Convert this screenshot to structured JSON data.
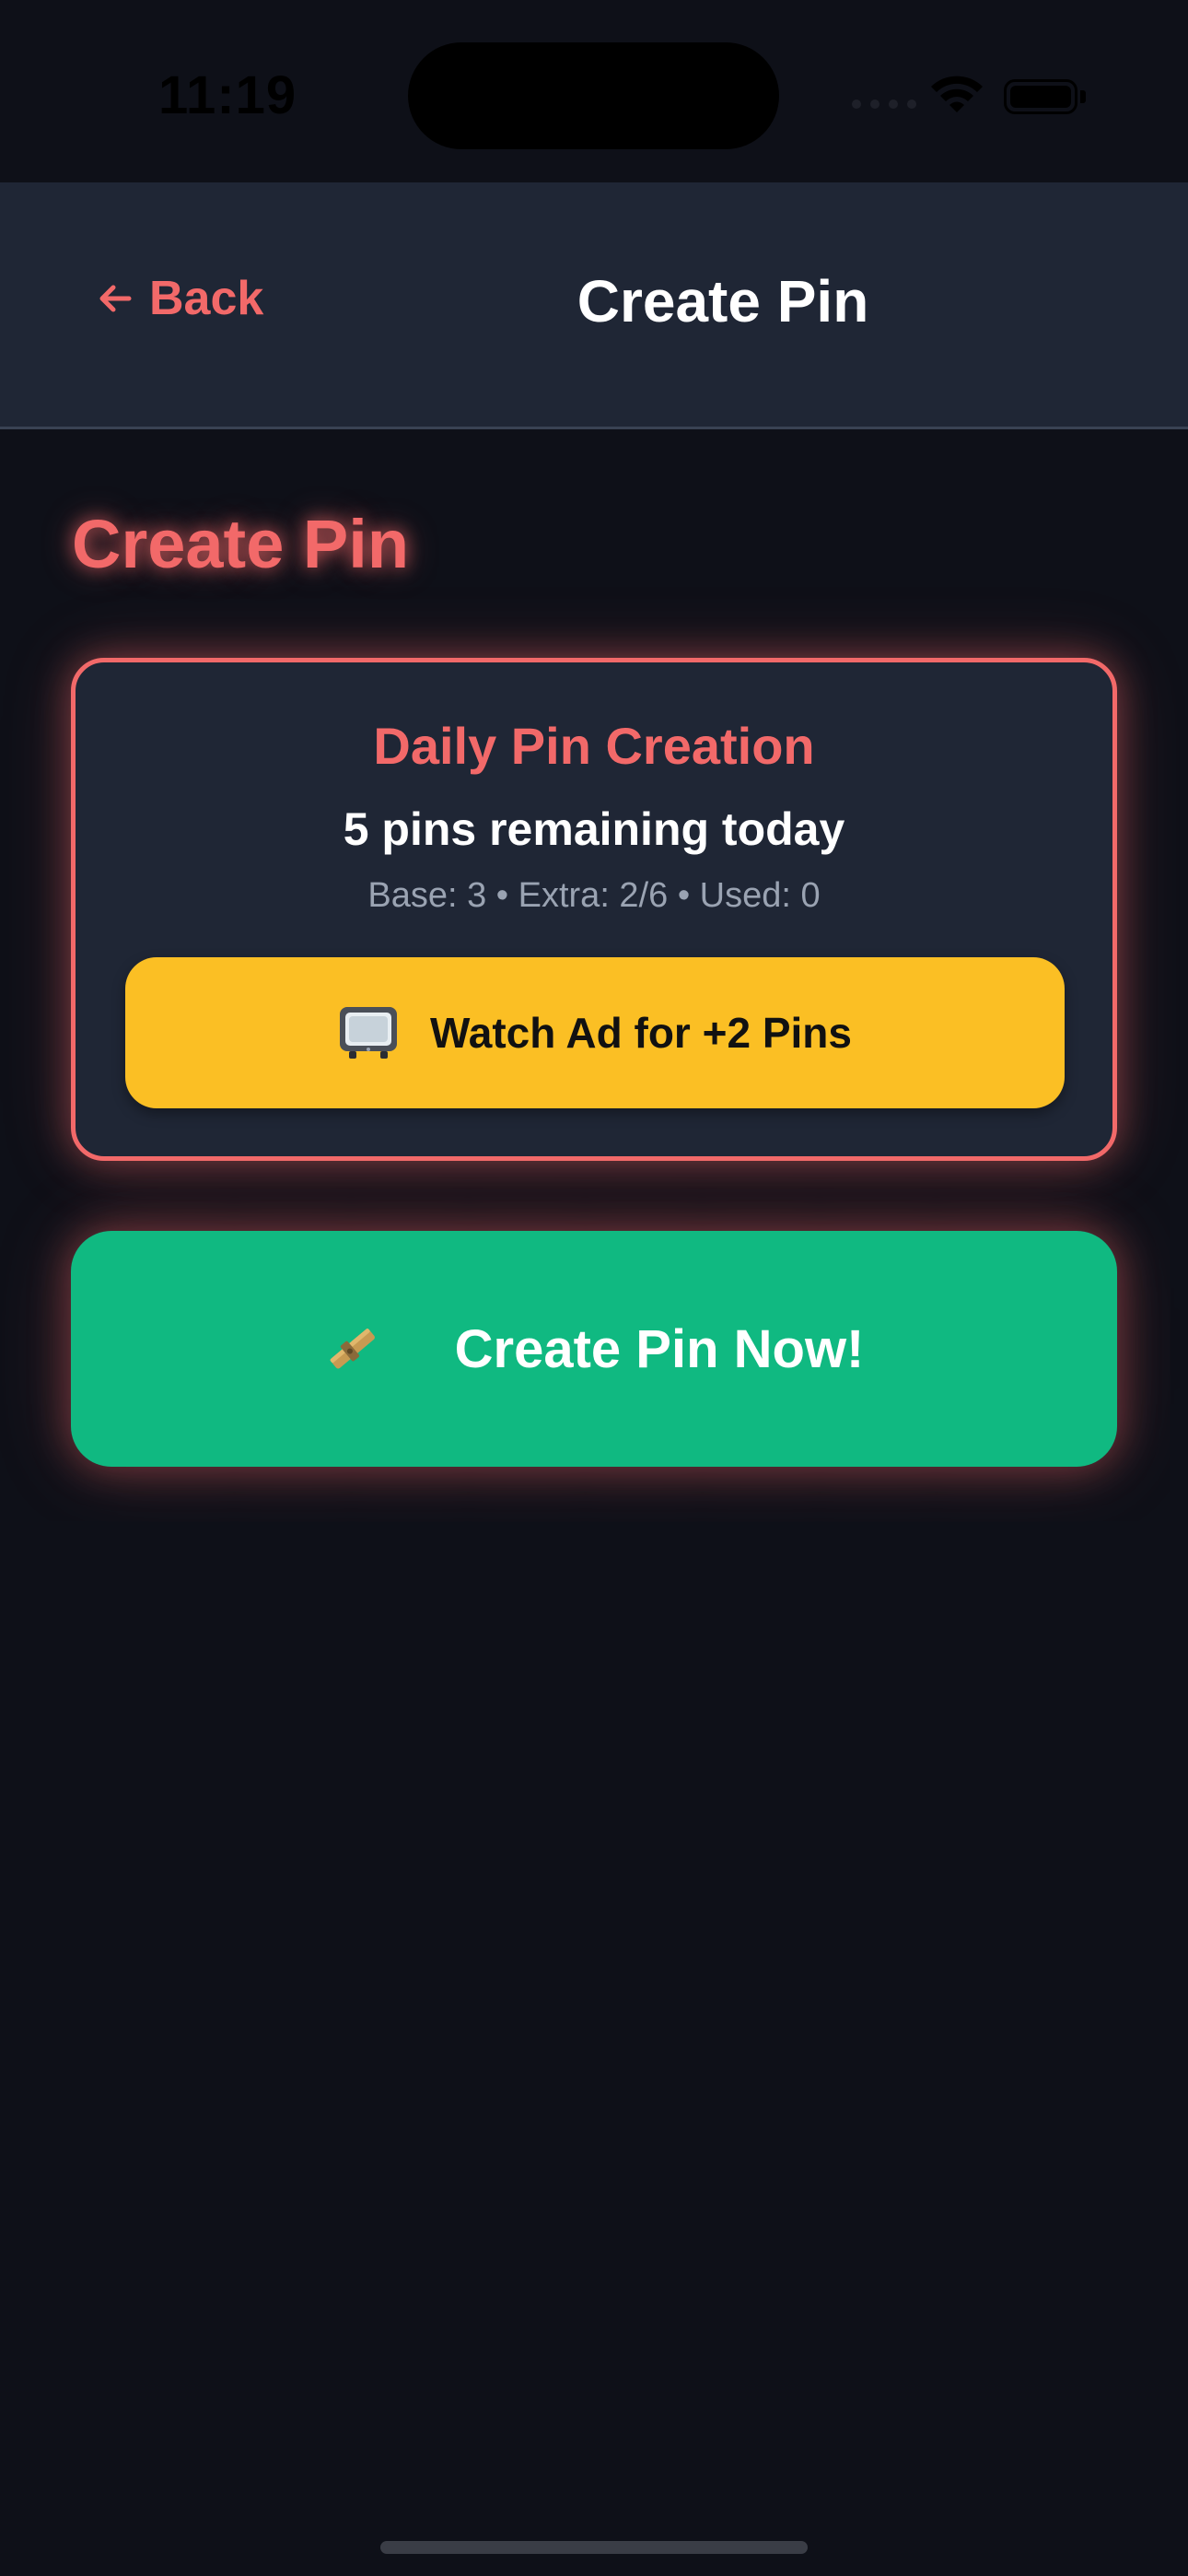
{
  "status_bar": {
    "time": "11:19"
  },
  "header": {
    "back_label": "Back",
    "title": "Create Pin"
  },
  "page": {
    "title": "Create Pin"
  },
  "daily_card": {
    "heading": "Daily Pin Creation",
    "remaining": "5 pins remaining today",
    "breakdown": "Base: 3 • Extra: 2/6 • Used: 0",
    "watch_ad_label": "Watch Ad for +2 Pins",
    "watch_ad_icon": "tv-icon"
  },
  "actions": {
    "create_pin_label": "Create Pin Now!",
    "create_pin_icon": "pin-icon"
  },
  "colors": {
    "accent": "#f26969",
    "card_bg": "#1f2635",
    "watch_ad_bg": "#fbbf24",
    "create_button_bg": "#10b981",
    "page_bg": "#0e1018"
  }
}
